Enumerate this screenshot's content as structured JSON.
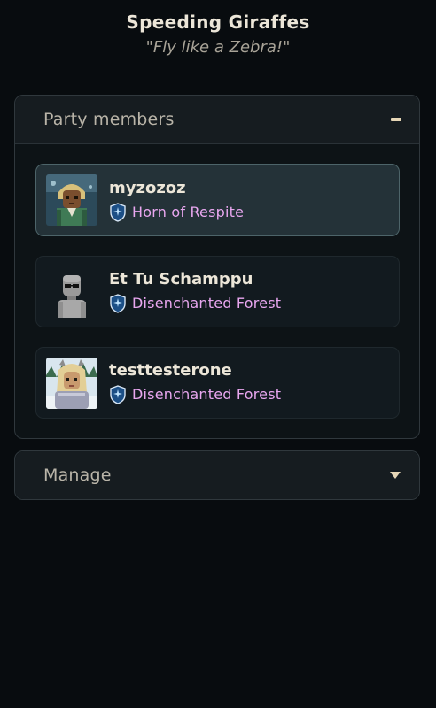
{
  "party": {
    "name": "Speeding Giraffes",
    "motto": "\"Fly like a Zebra!\""
  },
  "members_panel": {
    "title": "Party members",
    "toggle_icon": "collapse-minus-icon",
    "members": [
      {
        "name": "myzozoz",
        "location": "Horn of Respite",
        "selected": true,
        "avatar_icon": "avatar-myzozoz"
      },
      {
        "name": "Et Tu Schamppu",
        "location": "Disenchanted Forest",
        "selected": false,
        "avatar_icon": "avatar-robot"
      },
      {
        "name": "testtesterone",
        "location": "Disenchanted Forest",
        "selected": false,
        "avatar_icon": "avatar-testtesterone"
      }
    ]
  },
  "manage_panel": {
    "title": "Manage",
    "toggle_icon": "expand-chevron-down-icon"
  },
  "colors": {
    "background": "#080c0f",
    "location_text": "#e9a7f0",
    "selected_card": "#243238",
    "accent": "#e6d6b6"
  }
}
